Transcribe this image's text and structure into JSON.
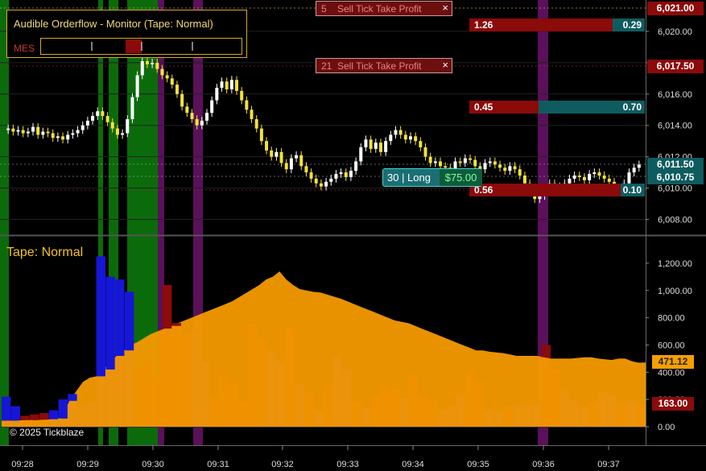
{
  "monitor": {
    "title": "Audible Orderflow - Monitor (Tape: Normal)",
    "symbol": "MES"
  },
  "orders": [
    {
      "qty": "5",
      "label": "Sell Tick Take Profit",
      "close": "×"
    },
    {
      "qty": "21",
      "label": "Sell Tick Take Profit",
      "close": "×"
    }
  ],
  "position": {
    "summary": "30 | Long",
    "pnl": "$75.00"
  },
  "volume_rows": [
    {
      "bid": "1.26",
      "ask": "0.29"
    },
    {
      "bid": "0.45",
      "ask": "0.70"
    },
    {
      "bid": "0.56",
      "ask": "0.10"
    }
  ],
  "price_axis": {
    "ticks": [
      "6,020.00",
      "6,018.00",
      "6,016.00",
      "6,014.00",
      "6,012.00",
      "6,010.00",
      "6,008.00"
    ],
    "tags": [
      {
        "value": "6,021.00",
        "color": "#8b0a0a"
      },
      {
        "value": "6,017.50",
        "color": "#8b0a0a"
      },
      {
        "value": "6,011.50",
        "color": "#0f5c60"
      },
      {
        "value": "6,010.75",
        "color": "#0f5c60"
      }
    ]
  },
  "tape": {
    "label": "Tape: Normal",
    "axis_ticks": [
      "1,200.00",
      "1,000.00",
      "800.00",
      "600.00",
      "400.00",
      "200.00",
      "0.00"
    ],
    "tags": [
      {
        "value": "471.12",
        "color": "#f5a000"
      },
      {
        "value": "163.00",
        "color": "#8b0a0a"
      }
    ]
  },
  "time_axis": [
    "09:28",
    "09:29",
    "09:30",
    "09:31",
    "09:32",
    "09:33",
    "09:34",
    "09:35",
    "09:36",
    "09:37"
  ],
  "copyright": "© 2025 Tickblaze",
  "chart_data": {
    "type": "candlestick",
    "price_range": [
      6007.0,
      6022.0
    ],
    "volume_range": [
      0,
      1300
    ],
    "price_series": [
      6013.7,
      6013.8,
      6013.6,
      6013.7,
      6013.5,
      6013.6,
      6013.9,
      6013.4,
      6013.6,
      6013.5,
      6013.2,
      6013.3,
      6013.1,
      6013.4,
      6013.5,
      6013.7,
      6014.0,
      6014.3,
      6014.6,
      6014.9,
      6014.6,
      6014.2,
      6013.8,
      6013.4,
      6013.5,
      6014.4,
      6015.8,
      6017.2,
      6018.1,
      6017.9,
      6018.0,
      6017.6,
      6017.2,
      6017.0,
      6016.6,
      6016.0,
      6015.2,
      6014.8,
      6014.4,
      6014.0,
      6014.3,
      6014.8,
      6015.6,
      6016.4,
      6016.8,
      6016.3,
      6016.9,
      6016.2,
      6015.6,
      6015.0,
      6014.4,
      6013.8,
      6013.0,
      6012.4,
      6012.0,
      6012.3,
      6011.6,
      6011.2,
      6011.9,
      6012.1,
      6011.4,
      6011.0,
      6010.6,
      6010.3,
      6010.1,
      6010.4,
      6010.6,
      6010.9,
      6011.0,
      6010.7,
      6011.1,
      6011.7,
      6012.6,
      6013.1,
      6012.5,
      6012.9,
      6012.3,
      6013.0,
      6013.4,
      6013.7,
      6013.4,
      6013.1,
      6013.3,
      6013.0,
      6012.6,
      6012.0,
      6011.6,
      6011.7,
      6011.4,
      6011.3,
      6011.2,
      6011.7,
      6011.6,
      6011.9,
      6011.8,
      6011.4,
      6011.2,
      6011.6,
      6011.7,
      6011.5,
      6011.3,
      6011.1,
      6011.4,
      6011.2,
      6010.8,
      6010.3,
      6009.7,
      6009.3,
      6009.5,
      6010.0,
      6010.3,
      6009.9,
      6010.1,
      6010.3,
      6010.6,
      6010.8,
      6010.7,
      6010.5,
      6010.9,
      6011.0,
      6010.8,
      6010.6,
      6010.4,
      6010.0,
      6009.8,
      6010.3,
      6011.0,
      6011.3,
      6011.5
    ],
    "ema_series": [
      45,
      46,
      44,
      48,
      50,
      47,
      52,
      55,
      60,
      80,
      190,
      260,
      330,
      360,
      370,
      420,
      480,
      520,
      560,
      600,
      620,
      650,
      680,
      700,
      720,
      740,
      760,
      780,
      800,
      820,
      840,
      860,
      880,
      900,
      920,
      950,
      980,
      1010,
      1040,
      1080,
      1100,
      1140,
      1080,
      1040,
      1010,
      1000,
      990,
      985,
      970,
      955,
      940,
      920,
      900,
      880,
      860,
      840,
      820,
      800,
      780,
      770,
      760,
      740,
      720,
      700,
      680,
      660,
      640,
      620,
      600,
      580,
      560,
      560,
      550,
      545,
      540,
      530,
      520,
      520,
      520,
      520,
      510,
      500,
      500,
      500,
      500,
      505,
      510,
      510,
      500,
      495,
      490,
      500,
      500,
      480,
      470,
      471
    ],
    "volume_bars": [
      [
        220,
        "b"
      ],
      [
        150,
        "b"
      ],
      [
        80,
        "r"
      ],
      [
        90,
        "r"
      ],
      [
        100,
        "r"
      ],
      [
        120,
        "b"
      ],
      [
        200,
        "b"
      ],
      [
        240,
        "b"
      ],
      [
        150,
        "b"
      ],
      [
        180,
        "b"
      ],
      [
        1250,
        "b"
      ],
      [
        1100,
        "b"
      ],
      [
        1080,
        "b"
      ],
      [
        990,
        "b"
      ],
      [
        440,
        "r"
      ],
      [
        500,
        "r"
      ],
      [
        350,
        "r"
      ],
      [
        1040,
        "r"
      ],
      [
        760,
        "r"
      ],
      [
        670,
        "r"
      ],
      [
        700,
        "b"
      ],
      [
        470,
        "b"
      ],
      [
        210,
        "r"
      ],
      [
        380,
        "r"
      ],
      [
        320,
        "r"
      ],
      [
        180,
        "r"
      ],
      [
        750,
        "r"
      ],
      [
        640,
        "r"
      ],
      [
        560,
        "b"
      ],
      [
        480,
        "b"
      ],
      [
        720,
        "r"
      ],
      [
        310,
        "b"
      ],
      [
        260,
        "r"
      ],
      [
        120,
        "b"
      ],
      [
        310,
        "r"
      ],
      [
        520,
        "b"
      ],
      [
        420,
        "b"
      ],
      [
        180,
        "r"
      ],
      [
        140,
        "b"
      ],
      [
        230,
        "r"
      ],
      [
        300,
        "r"
      ],
      [
        270,
        "r"
      ],
      [
        210,
        "b"
      ],
      [
        380,
        "r"
      ],
      [
        220,
        "r"
      ],
      [
        200,
        "r"
      ],
      [
        130,
        "b"
      ],
      [
        160,
        "b"
      ],
      [
        230,
        "b"
      ],
      [
        410,
        "r"
      ],
      [
        330,
        "r"
      ],
      [
        120,
        "b"
      ],
      [
        110,
        "b"
      ],
      [
        150,
        "r"
      ],
      [
        170,
        "b"
      ],
      [
        150,
        "b"
      ],
      [
        160,
        "b"
      ],
      [
        600,
        "r"
      ],
      [
        420,
        "r"
      ],
      [
        280,
        "b"
      ],
      [
        190,
        "b"
      ],
      [
        150,
        "b"
      ],
      [
        180,
        "r"
      ],
      [
        250,
        "b"
      ],
      [
        230,
        "b"
      ],
      [
        160,
        "r"
      ],
      [
        190,
        "b"
      ],
      [
        163,
        "r"
      ]
    ]
  }
}
